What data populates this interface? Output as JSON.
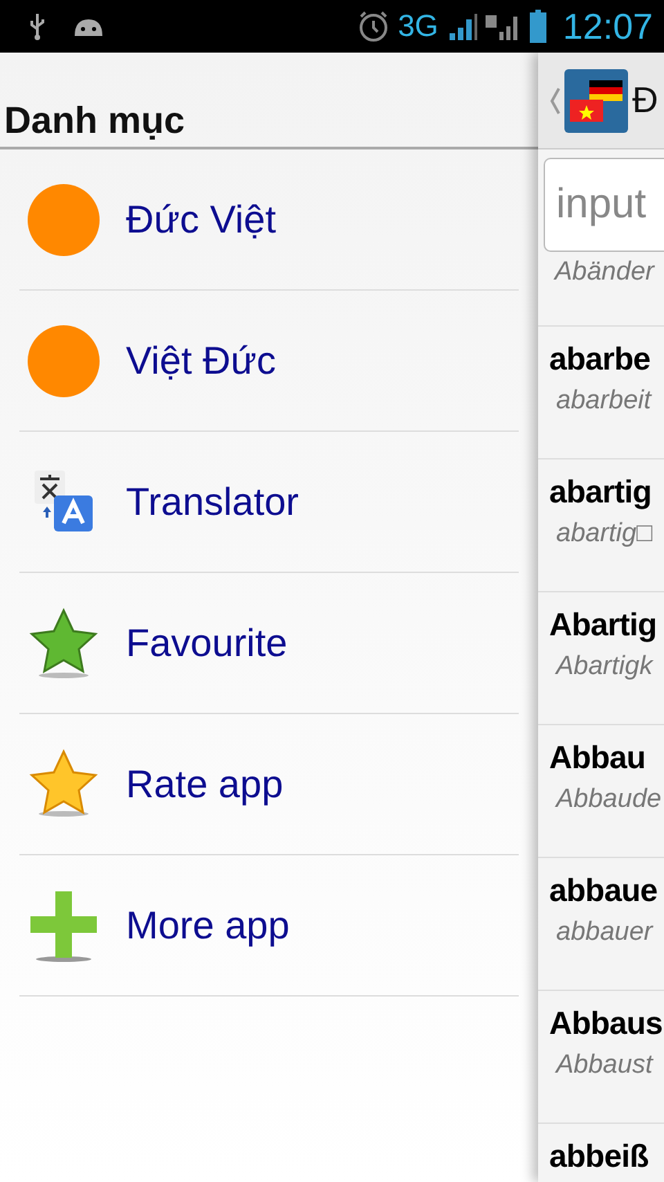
{
  "status_bar": {
    "network": "3G",
    "time": "12:07"
  },
  "drawer": {
    "title": "Danh mục",
    "items": [
      {
        "kind": "dot",
        "label": "Đức Việt"
      },
      {
        "kind": "dot",
        "label": "Việt Đức"
      },
      {
        "kind": "translate",
        "label": "Translator"
      },
      {
        "kind": "green-star",
        "label": "Favourite"
      },
      {
        "kind": "gold-star",
        "label": "Rate app"
      },
      {
        "kind": "plus",
        "label": "More app"
      }
    ]
  },
  "main": {
    "title": "Đ",
    "search": {
      "placeholder": "input"
    },
    "first_hint": "Abänder",
    "entries": [
      {
        "word": "abarbe",
        "meaning": "abarbeit"
      },
      {
        "word": "abartig",
        "meaning": "abartig□"
      },
      {
        "word": "Abartig",
        "meaning": "Abartigk"
      },
      {
        "word": "Abbau",
        "meaning": "Abbaude"
      },
      {
        "word": "abbaue",
        "meaning": "abbauer"
      },
      {
        "word": "Abbaus",
        "meaning": "Abbaust"
      },
      {
        "word": "abbeiß"
      }
    ]
  }
}
